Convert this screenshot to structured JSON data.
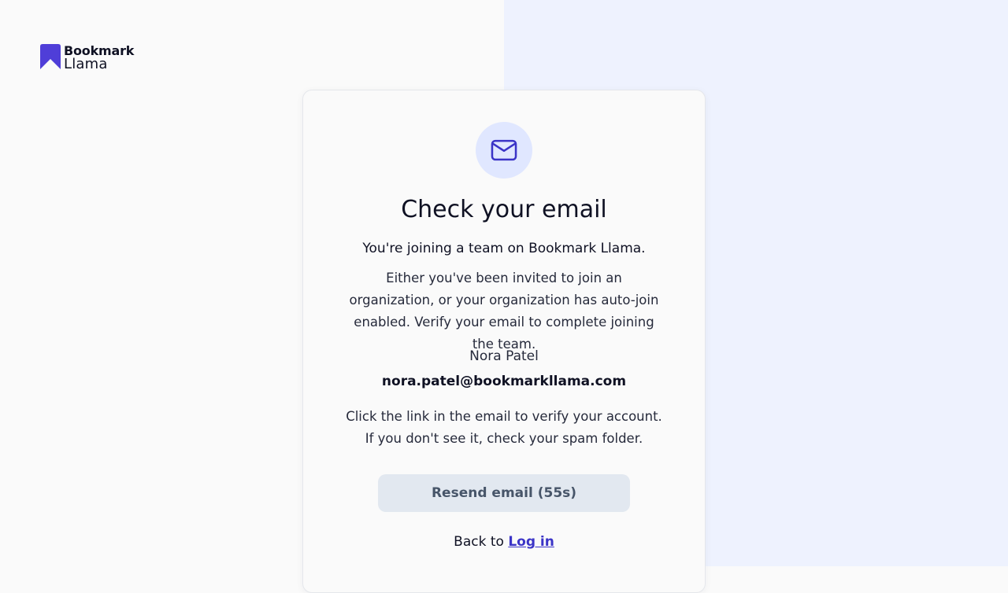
{
  "brand": {
    "line1": "Bookmark",
    "line2": "Llama",
    "icon": "bookmark-logo-icon",
    "color": "#4f3ed8"
  },
  "card": {
    "icon": "mail-icon",
    "title": "Check your email",
    "subtitle": "You're joining a team on Bookmark Llama.",
    "description": "Either you've been invited to join an organization, or your organization has auto-join enabled. Verify your email to complete joining the team.",
    "user_name": "Nora Patel",
    "user_email": "nora.patel@bookmarkllama.com",
    "note": "Click the link in the email to verify your account. If you don't see it, check your spam folder.",
    "resend_label": "Resend email (55s)",
    "back_prefix": "Back to ",
    "back_link": "Log in"
  },
  "colors": {
    "accent": "#3b34c7",
    "icon_bg": "#e0e7ff",
    "right_panel_bg": "#eef2fe",
    "button_bg": "#e2e8f0"
  }
}
